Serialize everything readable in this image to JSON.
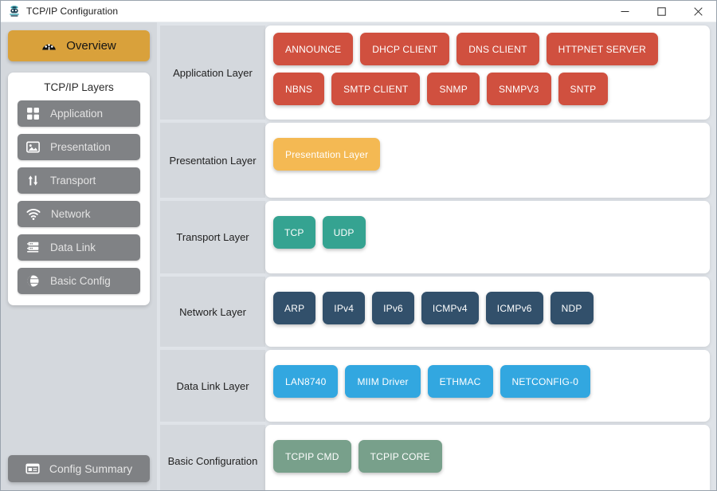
{
  "window": {
    "title": "TCP/IP Configuration",
    "app_icon": "network-stack-icon",
    "minimize_label": "─",
    "maximize_label": "□",
    "close_label": "✕"
  },
  "sidebar": {
    "overview": {
      "label": "Overview",
      "icon": "dashboard-gauge-icon",
      "color": "#d9a13b"
    },
    "layers_card_title": "TCP/IP Layers",
    "layer_buttons": [
      {
        "label": "Application",
        "icon": "grid-squares-icon"
      },
      {
        "label": "Presentation",
        "icon": "image-picture-icon"
      },
      {
        "label": "Transport",
        "icon": "up-down-arrows-icon"
      },
      {
        "label": "Network",
        "icon": "wifi-icon"
      },
      {
        "label": "Data Link",
        "icon": "server-rack-icon"
      },
      {
        "label": "Basic Config",
        "icon": "globe-icon"
      }
    ],
    "config_summary": {
      "label": "Config Summary",
      "icon": "window-list-icon"
    }
  },
  "main": {
    "rows": [
      {
        "label": "Application Layer",
        "color": "#d0503f",
        "items": [
          "ANNOUNCE",
          "DHCP CLIENT",
          "DNS CLIENT",
          "HTTPNET SERVER",
          "NBNS",
          "SMTP CLIENT",
          "SNMP",
          "SNMPV3",
          "SNTP"
        ]
      },
      {
        "label": "Presentation Layer",
        "color": "#f4b953",
        "items": [
          "Presentation Layer"
        ]
      },
      {
        "label": "Transport Layer",
        "color": "#35a391",
        "items": [
          "TCP",
          "UDP"
        ]
      },
      {
        "label": "Network Layer",
        "color": "#32506b",
        "items": [
          "ARP",
          "IPv4",
          "IPv6",
          "ICMPv4",
          "ICMPv6",
          "NDP"
        ]
      },
      {
        "label": "Data Link Layer",
        "color": "#32a7e0",
        "items": [
          "LAN8740",
          "MIIM Driver",
          "ETHMAC",
          "NETCONFIG-0"
        ]
      },
      {
        "label": "Basic Configuration",
        "color": "#78a08b",
        "items": [
          "TCPIP CMD",
          "TCPIP CORE"
        ]
      }
    ]
  }
}
